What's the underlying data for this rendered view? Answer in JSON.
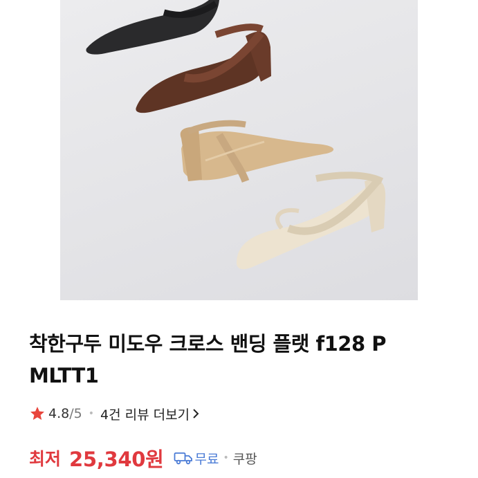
{
  "product": {
    "title_line1": "착한구두 미도우 크로스 밴딩 플랫 f128 P",
    "title_line2": "MLTT1",
    "image_alt": "shoes product photo"
  },
  "rating": {
    "value": "4.8",
    "max": "/5",
    "separator": "•",
    "reviews_label": "4건 리뷰 더보기",
    "chevron": "›"
  },
  "price": {
    "label": "최저",
    "amount": "25,340원",
    "shipping": "무료",
    "separator": "•",
    "seller": "쿠팡"
  },
  "colors": {
    "accent_red": "#e0393e",
    "shipping_blue": "#4a7bd6",
    "star": "#e8453c"
  },
  "icons": {
    "zoom": "search-icon",
    "star": "star-icon",
    "shipping": "truck-icon",
    "more": "chevron-right-icon"
  }
}
